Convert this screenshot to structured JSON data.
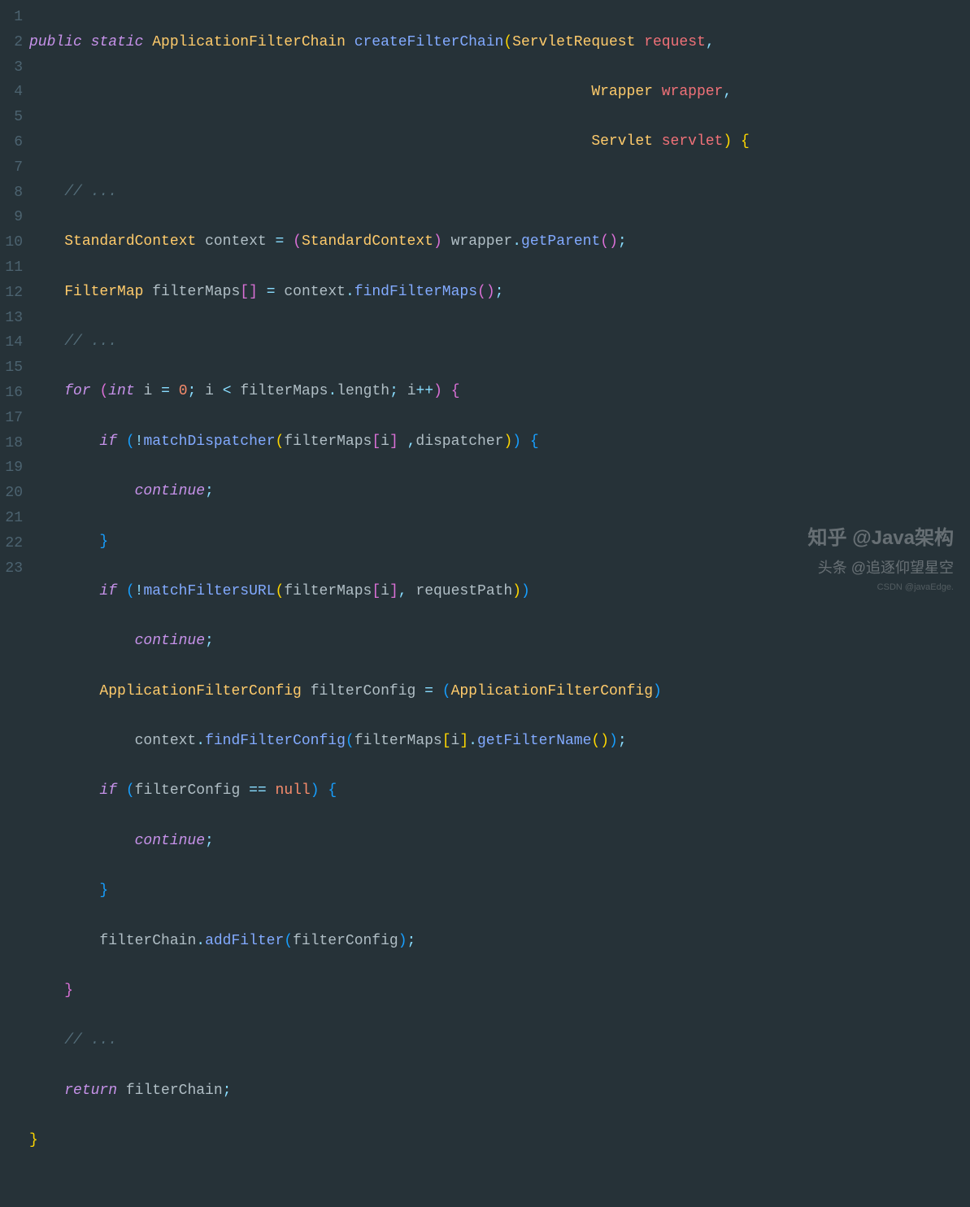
{
  "lineNumbers": [
    "1",
    "2",
    "3",
    "4",
    "5",
    "6",
    "7",
    "8",
    "9",
    "10",
    "11",
    "12",
    "13",
    "14",
    "15",
    "16",
    "17",
    "18",
    "19",
    "20",
    "21",
    "22",
    "23"
  ],
  "code": {
    "l1": {
      "public": "public",
      "static": "static",
      "type": "ApplicationFilterChain",
      "fn": "createFilterChain",
      "p1t": "ServletRequest",
      "p1n": "request"
    },
    "l2": {
      "p2t": "Wrapper",
      "p2n": "wrapper"
    },
    "l3": {
      "p3t": "Servlet",
      "p3n": "servlet"
    },
    "l4": {
      "cmt": "// ..."
    },
    "l5": {
      "type": "StandardContext",
      "var": "context",
      "cast": "StandardContext",
      "obj": "wrapper",
      "fn": "getParent"
    },
    "l6": {
      "type": "FilterMap",
      "var": "filterMaps",
      "obj": "context",
      "fn": "findFilterMaps"
    },
    "l7": {
      "cmt": "// ..."
    },
    "l8": {
      "for": "for",
      "int": "int",
      "i": "i",
      "zero": "0",
      "arr": "filterMaps",
      "len": "length"
    },
    "l9": {
      "if": "if",
      "fn": "matchDispatcher",
      "arr": "filterMaps",
      "i": "i",
      "d": "dispatcher"
    },
    "l10": {
      "continue": "continue"
    },
    "l12": {
      "if": "if",
      "fn": "matchFiltersURL",
      "arr": "filterMaps",
      "i": "i",
      "rp": "requestPath"
    },
    "l13": {
      "continue": "continue"
    },
    "l14": {
      "type": "ApplicationFilterConfig",
      "var": "filterConfig",
      "cast": "ApplicationFilterConfig"
    },
    "l15": {
      "obj": "context",
      "fn": "findFilterConfig",
      "arr": "filterMaps",
      "i": "i",
      "fn2": "getFilterName"
    },
    "l16": {
      "if": "if",
      "var": "filterConfig",
      "null": "null"
    },
    "l17": {
      "continue": "continue"
    },
    "l19": {
      "obj": "filterChain",
      "fn": "addFilter",
      "arg": "filterConfig"
    },
    "l21": {
      "cmt": "// ..."
    },
    "l22": {
      "return": "return",
      "var": "filterChain"
    }
  },
  "watermark": {
    "line1": "知乎  @Java架构",
    "line2": "头条 @追逐仰望星空",
    "line3": "CSDN @javaEdge."
  }
}
